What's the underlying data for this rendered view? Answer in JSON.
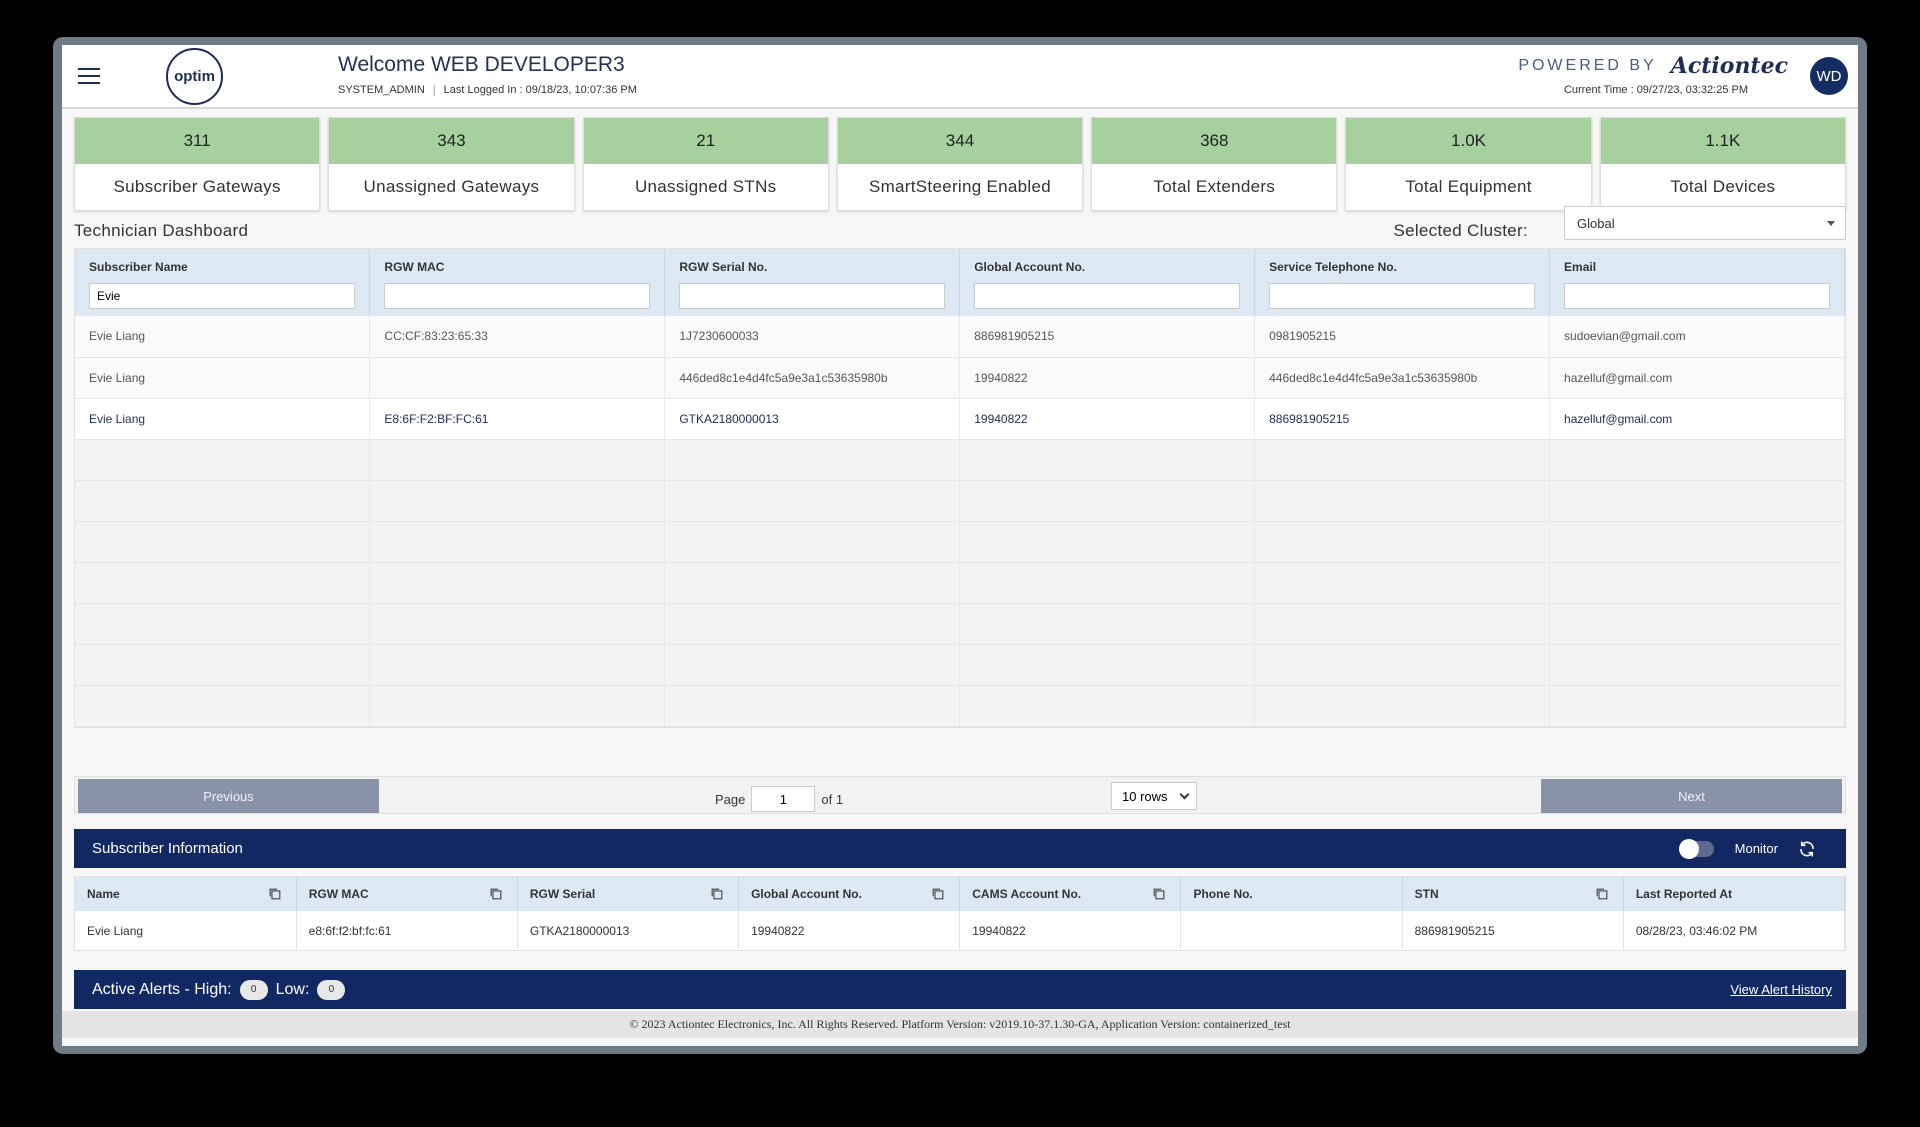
{
  "header": {
    "welcome": "Welcome WEB DEVELOPER3",
    "role": "SYSTEM_ADMIN",
    "last_logged_in": "Last Logged In : 09/18/23, 10:07:36 PM",
    "logo_text": "optim",
    "powered_by": "POWERED BY",
    "brand": "Actiontec",
    "current_time": "Current Time : 09/27/23, 03:32:25 PM",
    "avatar_initials": "WD"
  },
  "cards": [
    {
      "value": "311",
      "label": "Subscriber Gateways"
    },
    {
      "value": "343",
      "label": "Unassigned Gateways"
    },
    {
      "value": "21",
      "label": "Unassigned STNs"
    },
    {
      "value": "344",
      "label": "SmartSteering Enabled"
    },
    {
      "value": "368",
      "label": "Total Extenders"
    },
    {
      "value": "1.0K",
      "label": "Total Equipment"
    },
    {
      "value": "1.1K",
      "label": "Total Devices"
    }
  ],
  "dashboard": {
    "title": "Technician Dashboard",
    "cluster_label": "Selected Cluster:",
    "cluster_value": "Global"
  },
  "grid": {
    "columns": [
      "Subscriber Name",
      "RGW MAC",
      "RGW Serial No.",
      "Global Account No.",
      "Service Telephone No.",
      "Email"
    ],
    "filters": [
      "Evie",
      "",
      "",
      "",
      "",
      ""
    ],
    "rows": [
      [
        "Evie Liang",
        "CC:CF:83:23:65:33",
        "1J7230600033",
        "886981905215",
        "0981905215",
        "sudoevian@gmail.com"
      ],
      [
        "Evie Liang",
        "",
        "446ded8c1e4d4fc5a9e3a1c53635980b",
        "19940822",
        "446ded8c1e4d4fc5a9e3a1c53635980b",
        "hazelluf@gmail.com"
      ],
      [
        "Evie Liang",
        "E8:6F:F2:BF:FC:61",
        "GTKA2180000013",
        "19940822",
        "886981905215",
        "hazelluf@gmail.com"
      ]
    ]
  },
  "pager": {
    "previous": "Previous",
    "next": "Next",
    "page_label": "Page",
    "page_value": "1",
    "of_label": "of 1",
    "rows_option": "10 rows"
  },
  "subscriber_info": {
    "title": "Subscriber Information",
    "monitor_label": "Monitor",
    "columns": [
      "Name",
      "RGW MAC",
      "RGW Serial",
      "Global Account No.",
      "CAMS Account No.",
      "Phone No.",
      "STN",
      "Last Reported At"
    ],
    "row": [
      "Evie Liang",
      "e8:6f:f2:bf:fc:61",
      "GTKA2180000013",
      "19940822",
      "19940822",
      "",
      "886981905215",
      "08/28/23, 03:46:02 PM"
    ]
  },
  "alerts": {
    "label_high": "Active Alerts - High:",
    "high_count": "0",
    "label_low": "Low:",
    "low_count": "0",
    "history_link": "View Alert History"
  },
  "footer": {
    "text": "© 2023 Actiontec Electronics, Inc. All Rights Reserved. Platform Version: v2019.10-37.1.30-GA, Application Version: containerized_test"
  },
  "colors": {
    "card_accent": "#a6d19f",
    "navy_bar": "#112863",
    "header_row": "#dce9f5",
    "pager_button": "#8993a8"
  }
}
